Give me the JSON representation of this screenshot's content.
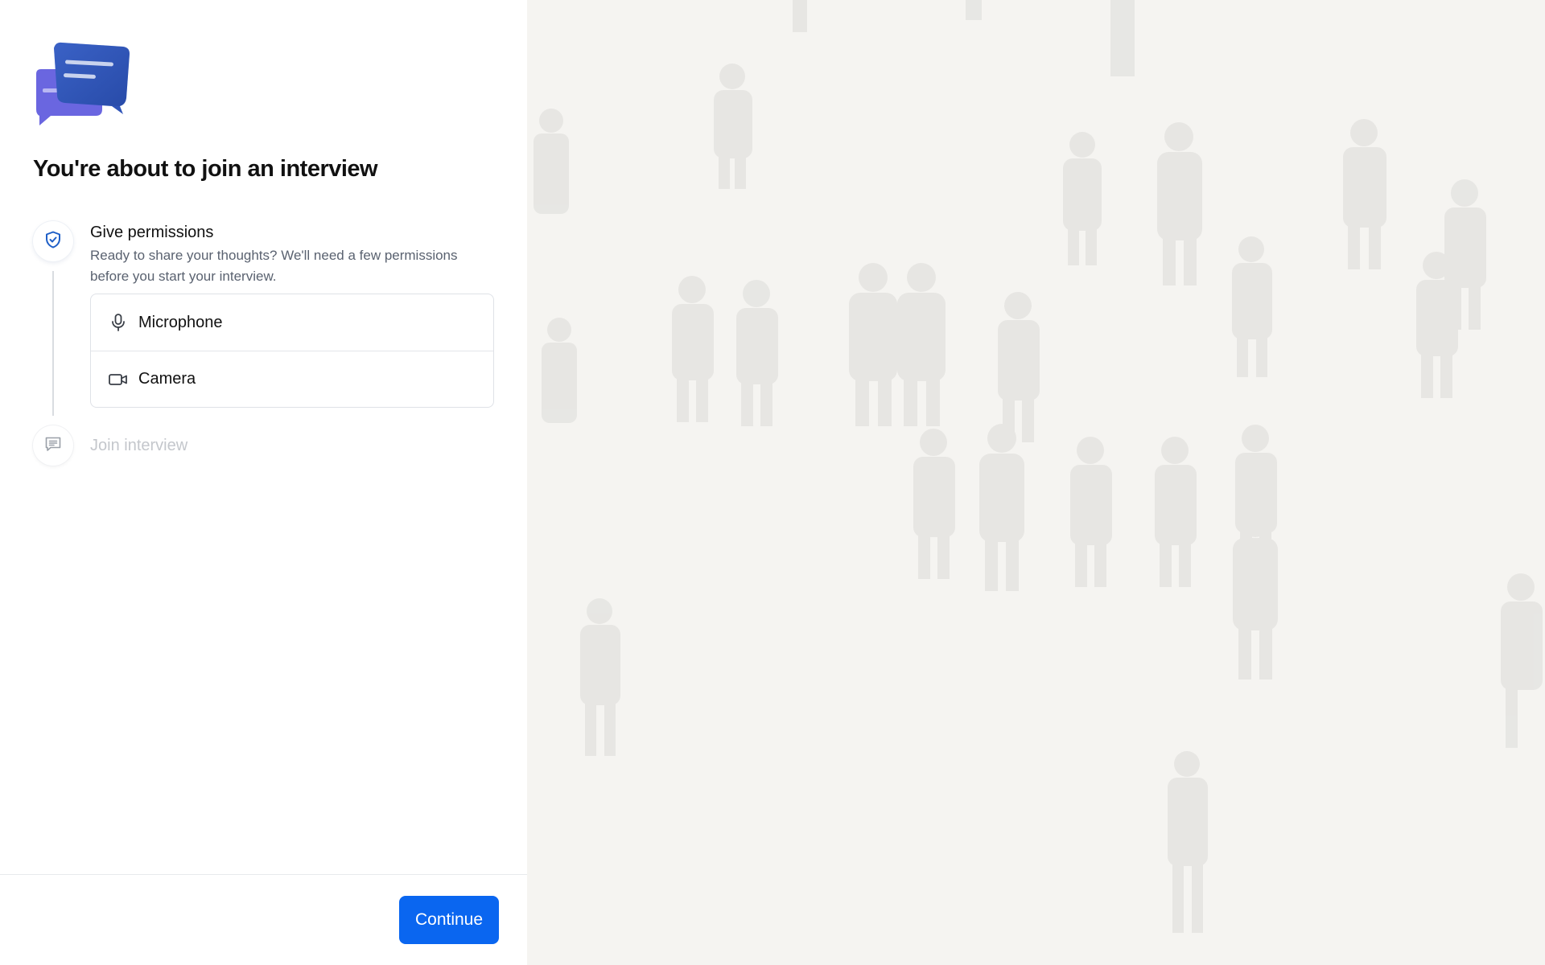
{
  "page": {
    "title": "You're about to join an interview"
  },
  "steps": [
    {
      "icon": "shield-check-icon",
      "title": "Give permissions",
      "description": "Ready to share your thoughts? We'll need a few permissions before you start your interview.",
      "state": "active"
    },
    {
      "icon": "message-square-icon",
      "title": "Join interview",
      "state": "inactive"
    }
  ],
  "permissions": [
    {
      "icon": "microphone-icon",
      "label": "Microphone"
    },
    {
      "icon": "camera-icon",
      "label": "Camera"
    }
  ],
  "footer": {
    "continue_label": "Continue"
  },
  "colors": {
    "accent": "#0a66f0",
    "shield_icon": "#1f5fc7",
    "right_panel_bg": "#f5f4f1",
    "muted_text": "#c4c7cc"
  }
}
